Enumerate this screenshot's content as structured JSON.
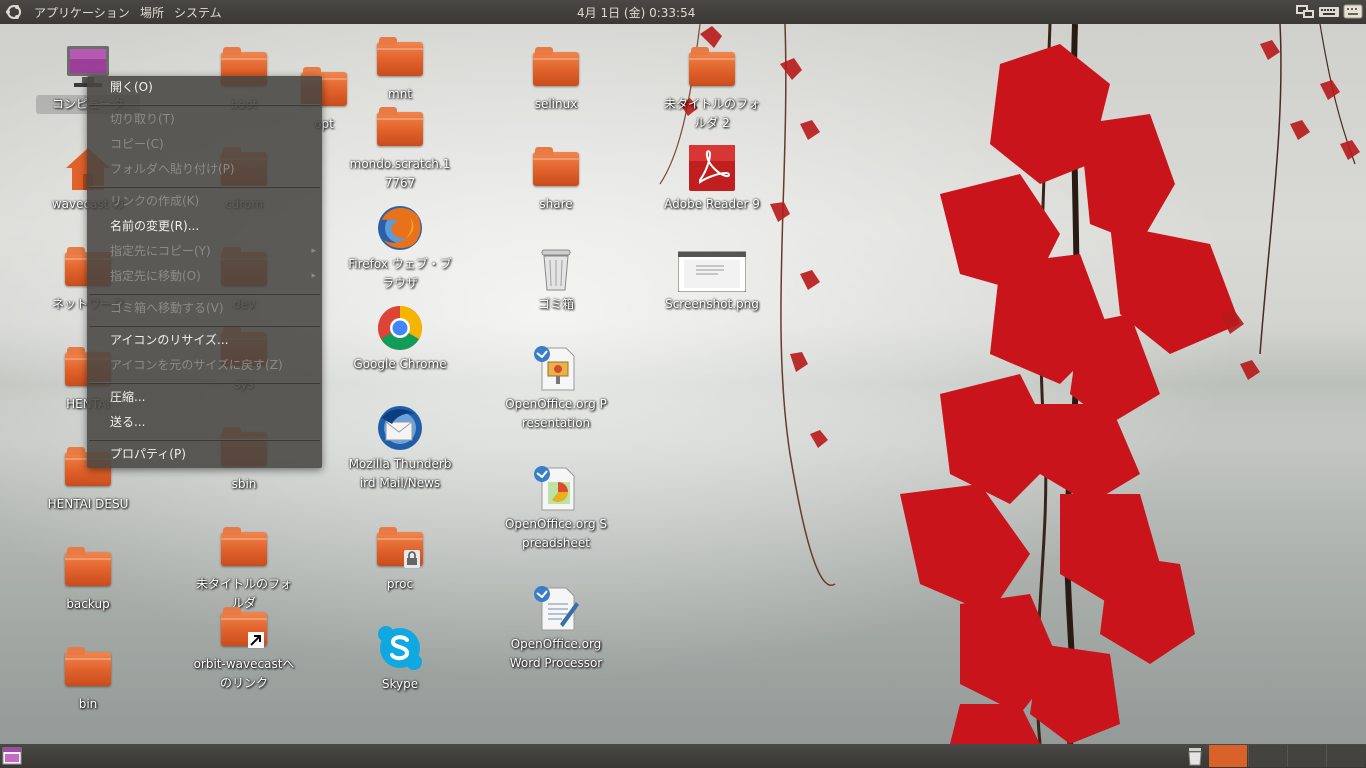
{
  "top_panel": {
    "menus": [
      "アプリケーション",
      "場所",
      "システム"
    ],
    "clock": "4月 1日 (金)  0:33:54"
  },
  "colors": {
    "panel": "#3c3b37",
    "folder": "#e0612a",
    "menu_bg": "#484642",
    "menu_text": "#f2f0ec",
    "menu_disabled": "#8c8a86"
  },
  "desktop_icons": {
    "computer": "コンピュータ",
    "boot": "boot",
    "opt": "opt",
    "mnt": "mnt",
    "mondo": "mondo.scratch.17767",
    "selinux": "selinux",
    "untitled2": "未タイトルのフォルダ 2",
    "wavecast": "wavecast の",
    "cdrom": "cdrom",
    "firefox": "Firefox ウェブ・ブラウザ",
    "share": "share",
    "adobe": "Adobe Reader 9",
    "network": "ネットワーク",
    "dev": "dev",
    "trash": "ゴミ箱",
    "screenshot": "Screenshot.png",
    "hentai1": "HENTAI",
    "sys": "sys",
    "chrome": "Google Chrome",
    "oo_presentation": "OpenOffice.org Presentation",
    "sbin": "sbin",
    "thunderbird": "Mozilla Thunderbird Mail/News",
    "hentai_desu": "HENTAI DESU",
    "oo_spreadsheet": "OpenOffice.org Spreadsheet",
    "untitled": "未タイトルのフォルダ",
    "proc": "proc",
    "backup": "backup",
    "oo_word": "OpenOffice.org Word Processor",
    "orbit_link": "orbit-wavecastへのリンク",
    "skype": "Skype",
    "bin": "bin"
  },
  "context_menu": {
    "items": [
      {
        "label": "開く(O)",
        "enabled": true
      },
      {
        "label": "切り取り(T)",
        "enabled": false
      },
      {
        "label": "コピー(C)",
        "enabled": false
      },
      {
        "label": "フォルダへ貼り付け(P)",
        "enabled": false
      },
      {
        "label": "リンクの作成(K)",
        "enabled": false
      },
      {
        "label": "名前の変更(R)...",
        "enabled": true
      },
      {
        "label": "指定先にコピー(Y)",
        "enabled": false
      },
      {
        "label": "指定先に移動(O)",
        "enabled": false
      },
      {
        "label": "ゴミ箱へ移動する(V)",
        "enabled": false
      },
      {
        "label": "アイコンのリサイズ...",
        "enabled": true
      },
      {
        "label": "アイコンを元のサイズに戻す(Z)",
        "enabled": false
      },
      {
        "label": "圧縮...",
        "enabled": true
      },
      {
        "label": "送る...",
        "enabled": true
      },
      {
        "label": "プロパティ(P)",
        "enabled": true
      }
    ]
  }
}
